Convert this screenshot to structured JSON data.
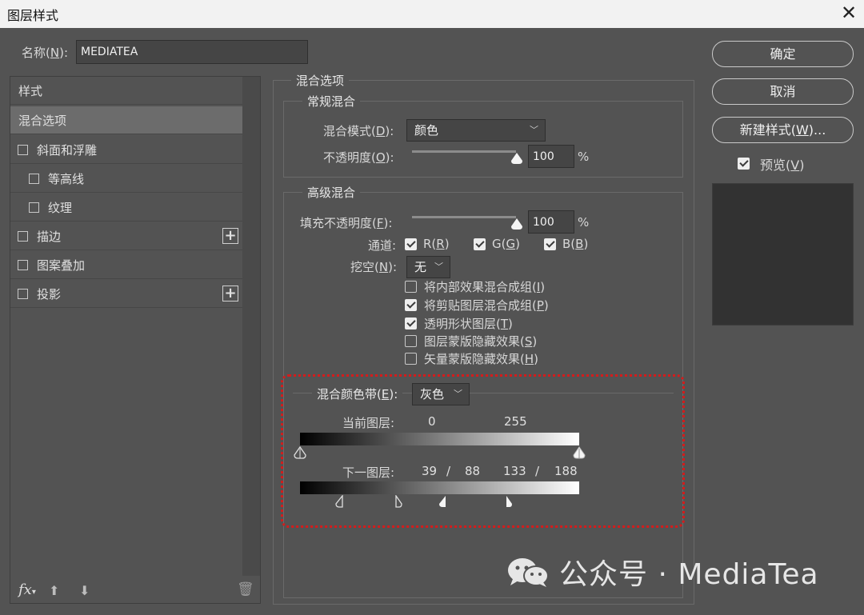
{
  "window": {
    "title": "图层样式"
  },
  "name_field": {
    "label": "名称(",
    "mnemonic": "N",
    "label_suffix": "):",
    "value": "MEDIATEA"
  },
  "sidebar": {
    "header": "样式",
    "items": [
      {
        "label": "混合选项",
        "checkbox": false,
        "active": true
      },
      {
        "label": "斜面和浮雕",
        "checkbox": true,
        "checked": false
      },
      {
        "label": "等高线",
        "checkbox": true,
        "checked": false,
        "indent": true
      },
      {
        "label": "纹理",
        "checkbox": true,
        "checked": false,
        "indent": true
      },
      {
        "label": "描边",
        "checkbox": true,
        "checked": false,
        "plus": true
      },
      {
        "label": "图案叠加",
        "checkbox": true,
        "checked": false
      },
      {
        "label": "投影",
        "checkbox": true,
        "checked": false,
        "plus": true
      }
    ],
    "footer": {
      "fx_label": "fx"
    }
  },
  "blend_options": {
    "title": "混合选项",
    "general": {
      "title": "常规混合",
      "mode_label": "混合模式(",
      "mode_mn": "D",
      "mode_suffix": "):",
      "mode_value": "颜色",
      "opacity_label": "不透明度(",
      "opacity_mn": "O",
      "opacity_suffix": "):",
      "opacity_value": "100",
      "opacity_unit": "%",
      "opacity_level": 1.0
    },
    "advanced": {
      "title": "高级混合",
      "fill_label": "填充不透明度(",
      "fill_mn": "F",
      "fill_suffix": "):",
      "fill_value": "100",
      "fill_unit": "%",
      "fill_level": 1.0,
      "channels_label": "通道:",
      "channels": [
        {
          "label": "R(",
          "mn": "R",
          "suffix": ")",
          "checked": true
        },
        {
          "label": "G(",
          "mn": "G",
          "suffix": ")",
          "checked": true
        },
        {
          "label": "B(",
          "mn": "B",
          "suffix": ")",
          "checked": true
        }
      ],
      "knockout_label": "挖空(",
      "knockout_mn": "N",
      "knockout_suffix": "):",
      "knockout_value": "无",
      "options": [
        {
          "label": "将内部效果混合成组(",
          "mn": "I",
          "suffix": ")",
          "checked": false
        },
        {
          "label": "将剪贴图层混合成组(",
          "mn": "P",
          "suffix": ")",
          "checked": true
        },
        {
          "label": "透明形状图层(",
          "mn": "T",
          "suffix": ")",
          "checked": true
        },
        {
          "label": "图层蒙版隐藏效果(",
          "mn": "S",
          "suffix": ")",
          "checked": false
        },
        {
          "label": "矢量蒙版隐藏效果(",
          "mn": "H",
          "suffix": ")",
          "checked": false
        }
      ]
    },
    "blend_if": {
      "label": "混合颜色带(",
      "mn": "E",
      "suffix": "):",
      "value": "灰色",
      "this_layer": {
        "label": "当前图层:",
        "black": "0",
        "white": "255"
      },
      "underlying": {
        "label": "下一图层:",
        "v1": "39",
        "sep1": "/",
        "v2": "88",
        "v3": "133",
        "sep2": "/",
        "v4": "188"
      }
    }
  },
  "buttons": {
    "ok": "确定",
    "cancel": "取消",
    "new_style": "新建样式(",
    "new_style_mn": "W",
    "new_style_suffix": ")...",
    "preview": "预览(",
    "preview_mn": "V",
    "preview_suffix": ")",
    "preview_checked": true
  },
  "watermark": {
    "text": "公众号 · MediaTea"
  },
  "colors": {
    "background": "#535353",
    "titlebar": "#f2f2f2",
    "highlight_border": "#d31c1c"
  }
}
